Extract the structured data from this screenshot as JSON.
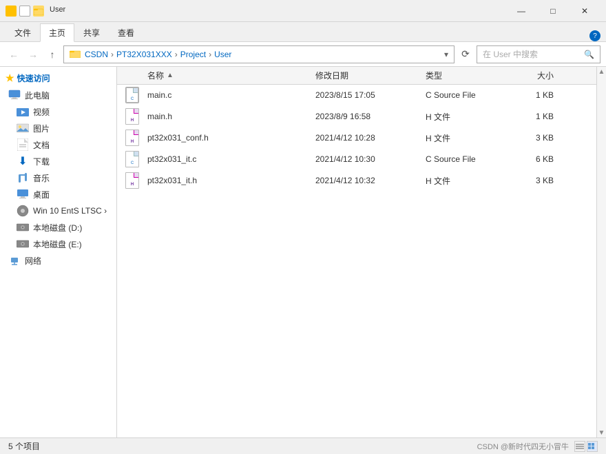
{
  "titleBar": {
    "title": "User",
    "windowControls": {
      "minimize": "—",
      "maximize": "□",
      "close": "✕"
    }
  },
  "ribbon": {
    "tabs": [
      "文件",
      "主页",
      "共享",
      "查看"
    ],
    "activeTab": "主页"
  },
  "addressBar": {
    "backBtn": "←",
    "forwardBtn": "→",
    "upBtn": "↑",
    "path": "CSDN › PT32X031XXX › Project › User",
    "refreshBtn": "⟳",
    "searchPlaceholder": "在 User 中搜索"
  },
  "columns": {
    "name": "名称",
    "date": "修改日期",
    "type": "类型",
    "size": "大小"
  },
  "files": [
    {
      "name": "main.c",
      "date": "2023/8/15 17:05",
      "type": "C Source File",
      "size": "1 KB",
      "ext": "c"
    },
    {
      "name": "main.h",
      "date": "2023/8/9 16:58",
      "type": "H 文件",
      "size": "1 KB",
      "ext": "h"
    },
    {
      "name": "pt32x031_conf.h",
      "date": "2021/4/12 10:28",
      "type": "H 文件",
      "size": "3 KB",
      "ext": "h"
    },
    {
      "name": "pt32x031_it.c",
      "date": "2021/4/12 10:30",
      "type": "C Source File",
      "size": "6 KB",
      "ext": "c"
    },
    {
      "name": "pt32x031_it.h",
      "date": "2021/4/12 10:32",
      "type": "H 文件",
      "size": "3 KB",
      "ext": "h"
    }
  ],
  "sidebar": {
    "quickAccess": "快速访问",
    "thisPC": "此电脑",
    "items": [
      {
        "name": "视频",
        "icon": "📹"
      },
      {
        "name": "图片",
        "icon": "🖼"
      },
      {
        "name": "文档",
        "icon": "📄"
      },
      {
        "name": "下载",
        "icon": "⬇"
      },
      {
        "name": "音乐",
        "icon": "🎵"
      },
      {
        "name": "桌面",
        "icon": "🖥"
      },
      {
        "name": "Win 10 EntS LTSC ›",
        "icon": "💿"
      },
      {
        "name": "本地磁盘 (D:)",
        "icon": "💾"
      },
      {
        "name": "本地磁盘 (E:)",
        "icon": "💾"
      },
      {
        "name": "网络",
        "icon": "🌐"
      }
    ]
  },
  "statusBar": {
    "itemCount": "5 个项目",
    "watermark": "CSDN @新时代四无小冒牛"
  },
  "helpBtn": "?"
}
